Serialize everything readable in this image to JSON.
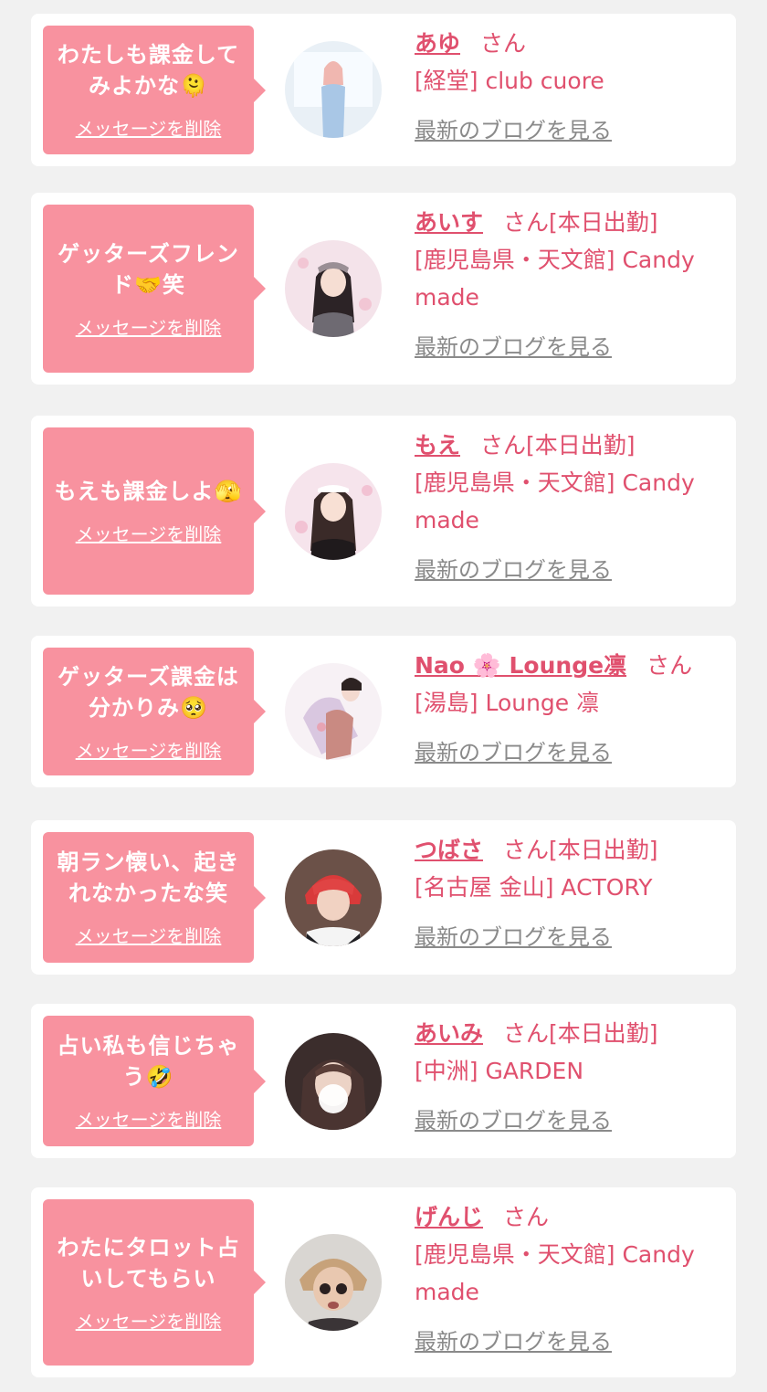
{
  "colors": {
    "background": "#f1f1f1",
    "card": "#ffffff",
    "bubble": "#f8929f",
    "accent": "#e0506e",
    "link_gray": "#8a8a8a"
  },
  "delete_label": "メッセージを削除",
  "blog_label": "最新のブログを見る",
  "san_label": "さん",
  "messages": [
    {
      "comment_lines": [
        "わたしも課金して",
        "みよかな🫠"
      ],
      "name": "あゆ",
      "badge": "",
      "shop": "[経堂] club cuore"
    },
    {
      "comment_lines": [
        "ゲッターズフレン",
        "ド🤝笑"
      ],
      "name": "あいす",
      "badge": "[本日出勤]",
      "shop": "[鹿児島県・天文館] Candy made"
    },
    {
      "comment_lines": [
        "もえも課金しよ🫣"
      ],
      "name": "もえ",
      "badge": "[本日出勤]",
      "shop": "[鹿児島県・天文館] Candy made"
    },
    {
      "comment_lines": [
        "ゲッターズ課金は",
        "分かりみ🥺"
      ],
      "name": "Nao 🌸 Lounge凛",
      "badge": "",
      "shop": "[湯島] Lounge 凛"
    },
    {
      "comment_lines": [
        "朝ラン懐い、起き",
        "れなかったな笑"
      ],
      "name": "つばさ",
      "badge": "[本日出勤]",
      "shop": "[名古屋 金山] ACTORY"
    },
    {
      "comment_lines": [
        "占い私も信じちゃ",
        "う🤣"
      ],
      "name": "あいみ",
      "badge": "[本日出勤]",
      "shop": "[中洲] GARDEN"
    },
    {
      "comment_lines": [
        "わたにタロット占",
        "いしてもらい"
      ],
      "name": "げんじ",
      "badge": "",
      "shop": "[鹿児島県・天文館] Candy made"
    }
  ]
}
